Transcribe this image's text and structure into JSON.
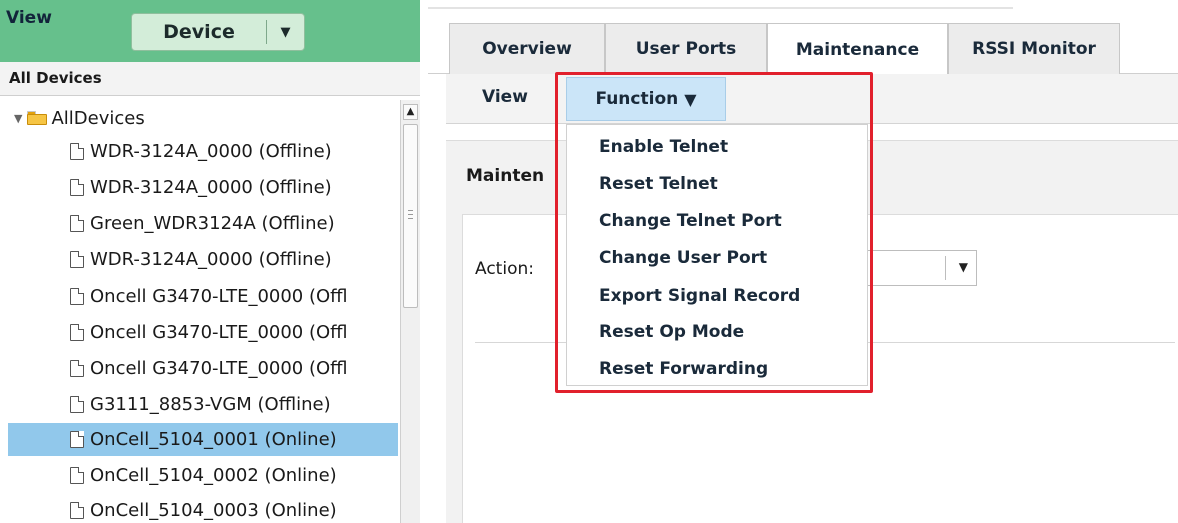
{
  "left_panel": {
    "view_label": "View",
    "view_selector": {
      "value": "Device",
      "arrow": "▼"
    },
    "section_header": "All Devices",
    "tree": {
      "root": {
        "label": "AllDevices",
        "expanded": true
      },
      "devices": [
        {
          "label": "WDR-3124A_0000 (Offline)",
          "selected": false
        },
        {
          "label": "WDR-3124A_0000 (Offline)",
          "selected": false
        },
        {
          "label": "Green_WDR3124A (Offline)",
          "selected": false
        },
        {
          "label": "WDR-3124A_0000 (Offline)",
          "selected": false
        },
        {
          "label": "Oncell G3470-LTE_0000 (Offl",
          "selected": false
        },
        {
          "label": "Oncell G3470-LTE_0000 (Offl",
          "selected": false
        },
        {
          "label": "Oncell G3470-LTE_0000 (Offl",
          "selected": false
        },
        {
          "label": "G3111_8853-VGM (Offline)",
          "selected": false
        },
        {
          "label": "OnCell_5104_0001 (Online)",
          "selected": true
        },
        {
          "label": "OnCell_5104_0002 (Online)",
          "selected": false
        },
        {
          "label": "OnCell_5104_0003 (Online)",
          "selected": false
        }
      ]
    },
    "scrollbar": {
      "up_arrow": "▲"
    }
  },
  "tabs": [
    {
      "label": "Overview",
      "active": false
    },
    {
      "label": "User Ports",
      "active": false
    },
    {
      "label": "Maintenance",
      "active": true
    },
    {
      "label": "RSSI Monitor",
      "active": false
    }
  ],
  "subbar": {
    "view_label": "View",
    "function_label": "Function",
    "function_arrow": "▼"
  },
  "content": {
    "title": "Mainten",
    "action_label": "Action:",
    "action_select": {
      "value": "",
      "arrow": "▼"
    }
  },
  "function_menu": {
    "items": [
      "Enable Telnet",
      "Reset Telnet",
      "Change Telnet Port",
      "Change User Port",
      "Export Signal Record",
      "Reset Op Mode",
      "Reset Forwarding"
    ]
  },
  "colors": {
    "view_bar": "#66c08c",
    "selected_row": "#91c8eb",
    "function_active": "#cbe5f8",
    "highlight_border": "#e1202c"
  }
}
